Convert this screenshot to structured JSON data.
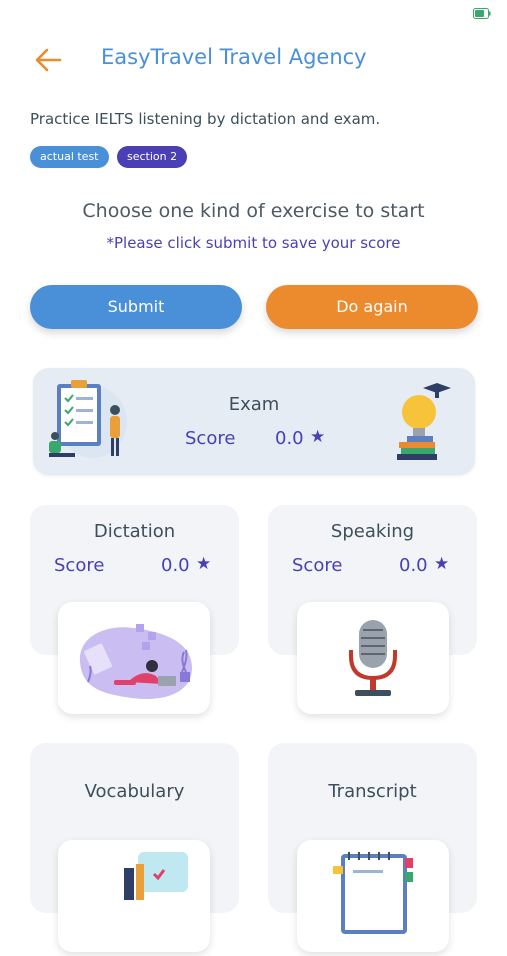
{
  "header": {
    "title": "EasyTravel Travel Agency"
  },
  "description": "Practice IELTS listening by dictation and exam.",
  "tags": [
    "actual test",
    "section 2"
  ],
  "heading": "Choose one kind of exercise to start",
  "note": "*Please click submit to save your score",
  "buttons": {
    "submit": "Submit",
    "again": "Do again"
  },
  "exam": {
    "title": "Exam",
    "score_label": "Score",
    "score": "0.0"
  },
  "dictation": {
    "title": "Dictation",
    "score_label": "Score",
    "score": "0.0"
  },
  "speaking": {
    "title": "Speaking",
    "score_label": "Score",
    "score": "0.0"
  },
  "vocabulary": {
    "title": "Vocabulary"
  },
  "transcript": {
    "title": "Transcript"
  },
  "colors": {
    "accent_blue": "#4a90d9",
    "accent_orange": "#ec8a2e",
    "indigo": "#4b3fb5"
  }
}
